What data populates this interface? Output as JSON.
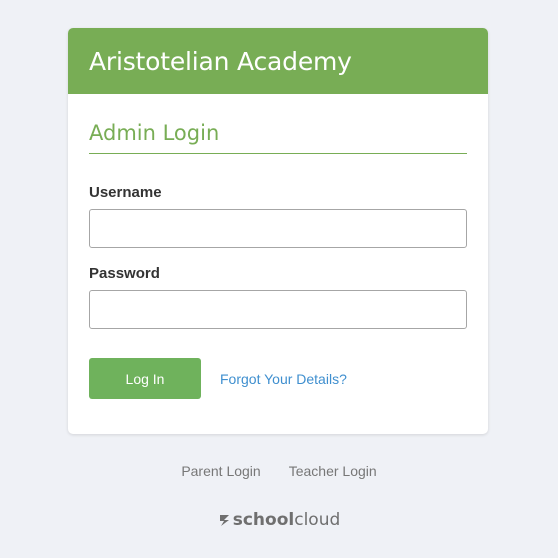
{
  "header": {
    "school_name": "Aristotelian Academy"
  },
  "form": {
    "title": "Admin Login",
    "username_label": "Username",
    "username_value": "",
    "password_label": "Password",
    "password_value": "",
    "login_button": "Log In",
    "forgot_link": "Forgot Your Details?"
  },
  "footer": {
    "links": [
      "Parent Login",
      "Teacher Login"
    ],
    "brand_bold": "school",
    "brand_light": "cloud",
    "brand_icon": "schoolcloud-logo-icon"
  },
  "colors": {
    "accent": "#78ad55",
    "button": "#6fb25c",
    "link": "#3f8fcf",
    "background": "#eff1f6"
  }
}
